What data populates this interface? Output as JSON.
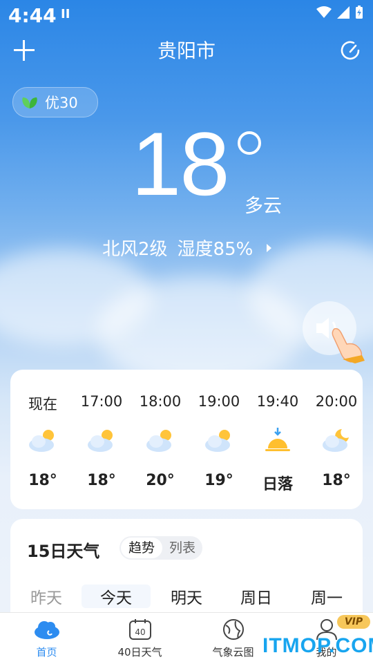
{
  "status": {
    "time": "4:44",
    "pause_glyph": "II"
  },
  "header": {
    "city": "贵阳市"
  },
  "aqi": {
    "label": "优30"
  },
  "current": {
    "temp": "18",
    "condition": "多云",
    "wind": "北风2级",
    "humidity": "湿度85%"
  },
  "hourly": [
    {
      "time": "现在",
      "icon": "partly-cloudy-icon",
      "value": "18°"
    },
    {
      "time": "17:00",
      "icon": "partly-cloudy-icon",
      "value": "18°"
    },
    {
      "time": "18:00",
      "icon": "partly-cloudy-icon",
      "value": "20°"
    },
    {
      "time": "19:00",
      "icon": "partly-cloudy-icon",
      "value": "19°"
    },
    {
      "time": "19:40",
      "icon": "sunset-icon",
      "value": "日落"
    },
    {
      "time": "20:00",
      "icon": "cloudy-night-icon",
      "value": "18°"
    }
  ],
  "daily": {
    "title": "15日天气",
    "toggle": [
      "趋势",
      "列表"
    ],
    "days": [
      "昨天",
      "今天",
      "明天",
      "周日",
      "周一"
    ]
  },
  "nav": [
    {
      "label": "首页",
      "icon": "cloud-home-icon",
      "active": true
    },
    {
      "label": "40日天气",
      "icon": "calendar-40-icon",
      "active": false
    },
    {
      "label": "气象云图",
      "icon": "globe-icon",
      "active": false
    },
    {
      "label": "我的",
      "icon": "user-icon",
      "active": false
    }
  ],
  "vip_badge": "VIP",
  "watermark": "ITMOP.COM",
  "colors": {
    "accent": "#2d8cf0",
    "sky_top": "#2b86e6",
    "vip": "#f7c75a"
  }
}
